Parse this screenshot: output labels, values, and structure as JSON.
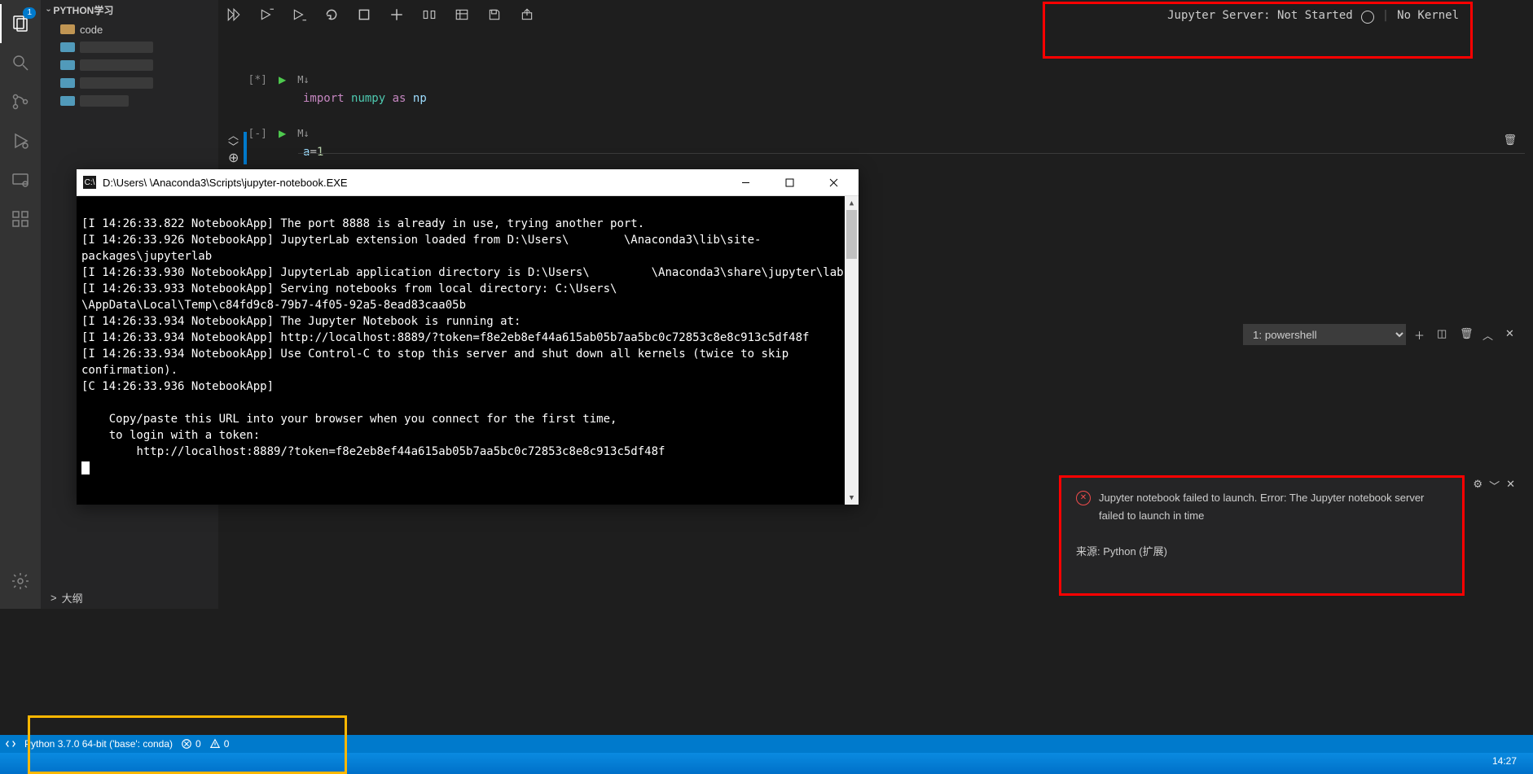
{
  "activity_badge": "1",
  "sidebar": {
    "header": "PYTHON学习",
    "items": [
      {
        "label": "code"
      },
      {
        "label": ""
      },
      {
        "label": ""
      },
      {
        "label": ""
      },
      {
        "label": ""
      }
    ],
    "outline_chev": ">",
    "outline_label": "大纲"
  },
  "jupyter_status": {
    "server_label": "Jupyter Server: Not Started",
    "kernel_label": "No Kernel"
  },
  "cells": [
    {
      "prompt": "[*]",
      "markdown": "M↓",
      "code_kw": "import",
      "code_mod": "numpy",
      "code_as": "as",
      "code_alias": "np"
    },
    {
      "prompt": "[-]",
      "markdown": "M↓",
      "code_raw": "a=1"
    }
  ],
  "cmd_window": {
    "title": "D:\\Users\\       \\Anaconda3\\Scripts\\jupyter-notebook.EXE",
    "lines": [
      "[I 14:26:33.822 NotebookApp] The port 8888 is already in use, trying another port.",
      "[I 14:26:33.926 NotebookApp] JupyterLab extension loaded from D:\\Users\\        \\Anaconda3\\lib\\site-packages\\jupyterlab",
      "[I 14:26:33.930 NotebookApp] JupyterLab application directory is D:\\Users\\         \\Anaconda3\\share\\jupyter\\lab",
      "[I 14:26:33.933 NotebookApp] Serving notebooks from local directory: C:\\Users\\        \\AppData\\Local\\Temp\\c84fd9c8-79b7-4f05-92a5-8ead83caa05b",
      "[I 14:26:33.934 NotebookApp] The Jupyter Notebook is running at:",
      "[I 14:26:33.934 NotebookApp] http://localhost:8889/?token=f8e2eb8ef44a615ab05b7aa5bc0c72853c8e8c913c5df48f",
      "[I 14:26:33.934 NotebookApp] Use Control-C to stop this server and shut down all kernels (twice to skip confirmation).",
      "[C 14:26:33.936 NotebookApp] ",
      "",
      "    Copy/paste this URL into your browser when you connect for the first time,",
      "    to login with a token:",
      "        http://localhost:8889/?token=f8e2eb8ef44a615ab05b7aa5bc0c72853c8e8c913c5df48f"
    ]
  },
  "terminal": {
    "dropdown": "1: powershell"
  },
  "notif": {
    "text": "Jupyter notebook failed to launch. Error: The Jupyter notebook server failed to launch in time",
    "source": "来源: Python (扩展)"
  },
  "statusbar": {
    "python": "Python 3.7.0 64-bit ('base': conda)",
    "errors": "0",
    "warnings": "0"
  },
  "taskbar": {
    "clock": "14:27"
  }
}
